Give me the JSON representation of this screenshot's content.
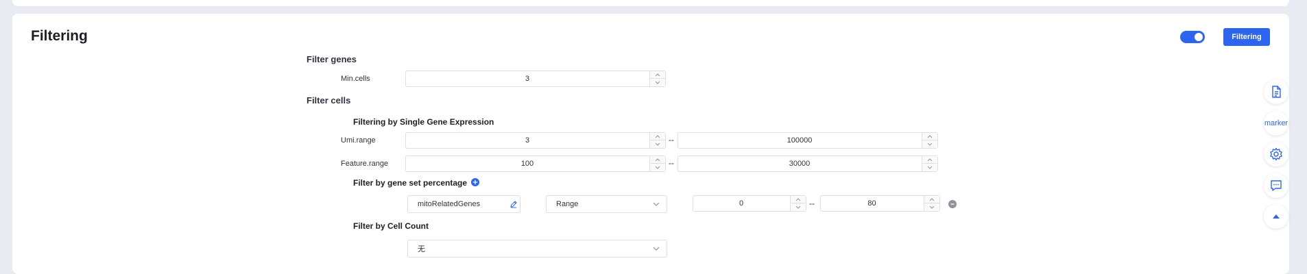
{
  "panel": {
    "title": "Filtering",
    "toggle_on": true,
    "run_button_label": "Filtering"
  },
  "filter_genes": {
    "title": "Filter genes",
    "min_cells_label": "Min.cells",
    "min_cells_value": "3"
  },
  "filter_cells": {
    "title": "Filter cells",
    "single_gene_title": "Filtering by Single Gene Expression",
    "umi_label": "Umi.range",
    "umi_min": "3",
    "umi_max": "100000",
    "feature_label": "Feature.range",
    "feature_min": "100",
    "feature_max": "30000",
    "range_separator": "--",
    "gene_set_title": "Filter by gene set percentage",
    "gene_set_name": "mitoRelatedGenes",
    "gene_set_mode": "Range",
    "gene_set_min": "0",
    "gene_set_max": "80",
    "cell_count_title": "Filter by Cell Count",
    "cell_count_value": "无"
  },
  "float_bar": {
    "document": "document-icon",
    "marker_label": "marker",
    "settings": "gear-icon",
    "chat": "chat-icon",
    "top": "arrow-up-icon"
  },
  "colors": {
    "accent": "#2d64f0",
    "background": "#e9ebf3"
  }
}
